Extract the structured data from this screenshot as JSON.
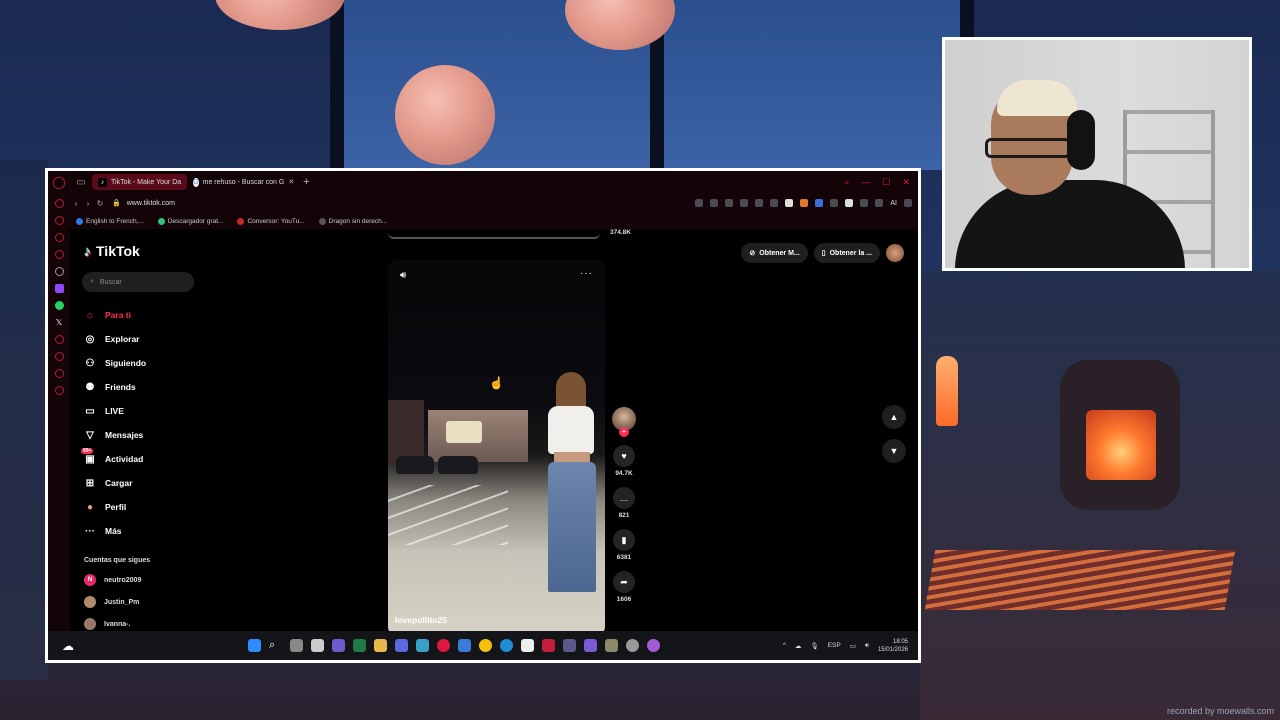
{
  "browser": {
    "tabs": [
      {
        "label": "TikTok - Make Your Da",
        "icon": "tiktok-icon",
        "active": true
      },
      {
        "label": "me rehuso - Buscar con G",
        "icon": "google-icon",
        "active": false
      }
    ],
    "url": "www.tiktok.com",
    "ai_label": "AI",
    "bookmarks": [
      "English to French,...",
      "Descargador grat...",
      "Conversor: YouTu...",
      "Dragon sin derech..."
    ]
  },
  "tiktok": {
    "logo": "TikTok",
    "search_placeholder": "Buscar",
    "nav": [
      {
        "label": "Para ti",
        "icon": "home-icon",
        "glyph": "⌂"
      },
      {
        "label": "Explorar",
        "icon": "compass-icon",
        "glyph": "◎"
      },
      {
        "label": "Siguiendo",
        "icon": "user-follow-icon",
        "glyph": "⚇"
      },
      {
        "label": "Friends",
        "icon": "friends-icon",
        "glyph": "⚉"
      },
      {
        "label": "LIVE",
        "icon": "live-icon",
        "glyph": "▭"
      },
      {
        "label": "Mensajes",
        "icon": "inbox-icon",
        "glyph": "▽"
      },
      {
        "label": "Actividad",
        "icon": "activity-icon",
        "glyph": "▣",
        "badge": "99+"
      },
      {
        "label": "Cargar",
        "icon": "upload-icon",
        "glyph": "⊞"
      },
      {
        "label": "Perfil",
        "icon": "profile-icon",
        "glyph": "●"
      },
      {
        "label": "Más",
        "icon": "more-icon",
        "glyph": "···"
      }
    ],
    "following_title": "Cuentas que sigues",
    "following": [
      {
        "name": "neutro2009",
        "initial": "N"
      },
      {
        "name": "Justin_Pm",
        "initial": ""
      },
      {
        "name": "Ivanna-.",
        "initial": ""
      }
    ],
    "top_buttons": [
      "Obtener M...",
      "Obtener la ..."
    ],
    "prev_count": "374.8K",
    "video": {
      "author": "lovepollito25",
      "likes": "94.7K",
      "comments": "821",
      "saves": "6381",
      "shares": "1606"
    }
  },
  "taskbar": {
    "language": "ESP",
    "time": "18:05",
    "date": "15/01/2026"
  },
  "watermark": "recorded by moewalls.com"
}
